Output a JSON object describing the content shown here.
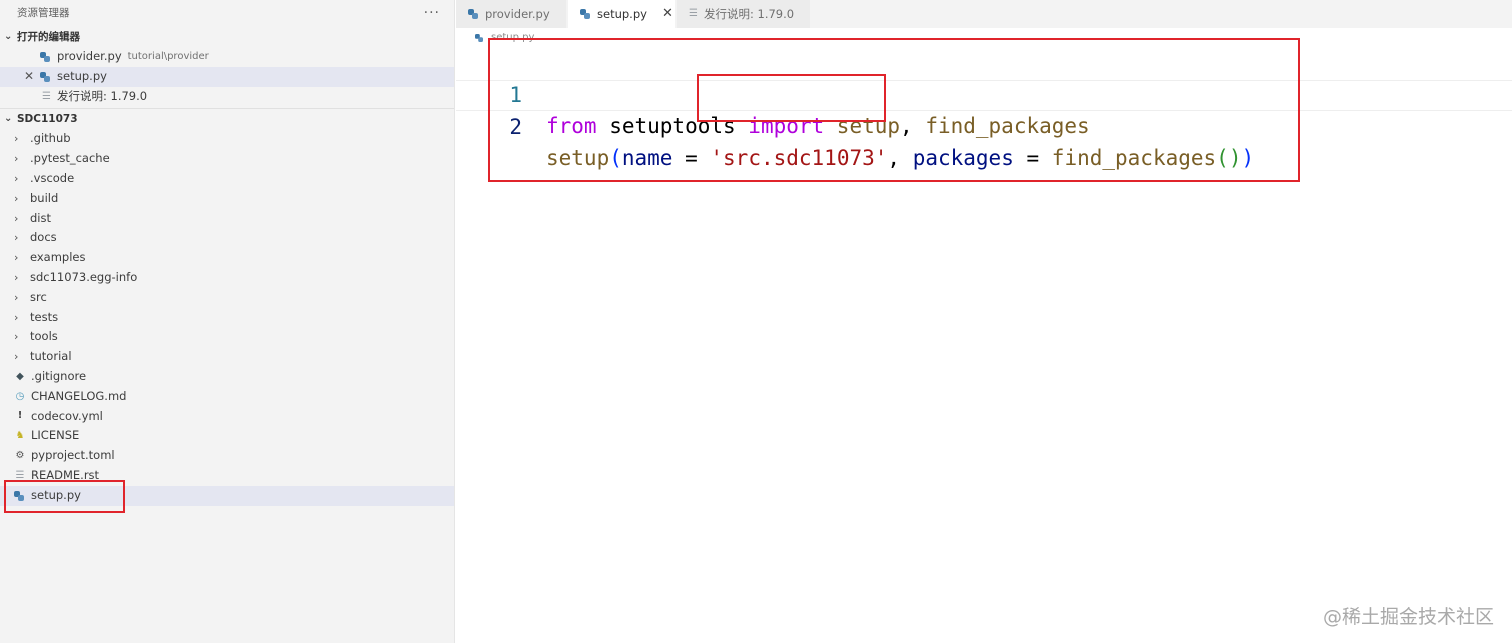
{
  "sidebar": {
    "title": "资源管理器",
    "more_label": "···",
    "open_editors": {
      "label": "打开的编辑器",
      "items": [
        {
          "name": "provider.py",
          "desc": "tutorial\\provider"
        },
        {
          "name": "setup.py",
          "desc": ""
        },
        {
          "name": "发行说明: 1.79.0",
          "desc": ""
        }
      ]
    },
    "workspace": {
      "label": "SDC11073",
      "folders": [
        ".github",
        ".pytest_cache",
        ".vscode",
        "build",
        "dist",
        "docs",
        "examples",
        "sdc11073.egg-info",
        "src",
        "tests",
        "tools",
        "tutorial"
      ],
      "files": [
        ".gitignore",
        "CHANGELOG.md",
        "codecov.yml",
        "LICENSE",
        "pyproject.toml",
        "README.rst",
        "setup.py"
      ]
    }
  },
  "tabs": [
    {
      "label": "provider.py",
      "active": false
    },
    {
      "label": "setup.py",
      "active": true,
      "close": "✕"
    },
    {
      "label": "发行说明: 1.79.0",
      "active": false
    }
  ],
  "editor": {
    "breadcrumb": "setup.py",
    "lines": [
      {
        "num": "1",
        "tokens": [
          "from",
          " setuptools ",
          "import",
          " setup",
          ", ",
          "find_packages"
        ]
      },
      {
        "num": "2",
        "tokens": [
          "setup",
          "(",
          "name",
          " = ",
          "'src.sdc11073'",
          ", ",
          "packages",
          " = ",
          "find_packages",
          "(",
          ")",
          ")"
        ]
      }
    ]
  },
  "watermark": "@稀土掘金技术社区",
  "colors": {
    "highlight_box": "#e0242b",
    "selection": "#e4e6f1",
    "keyword": "#af00db",
    "string": "#a31515"
  }
}
